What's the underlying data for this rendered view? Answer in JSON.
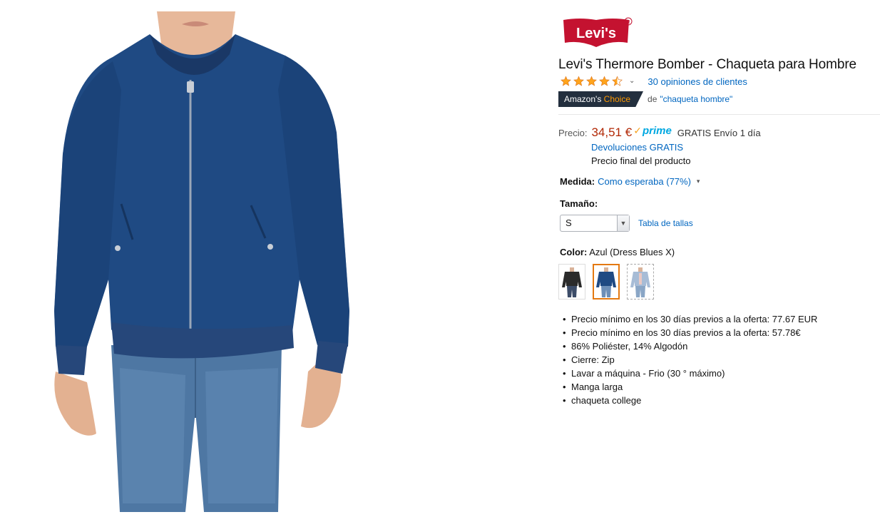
{
  "brand": {
    "logo_text": "Levi's",
    "logo_color": "#c41230"
  },
  "product": {
    "title": "Levi's Thermore Bomber - Chaqueta para Hombre",
    "rating_stars": 4.5,
    "reviews_link": "30 opiniones de clientes",
    "badge_prefix": "Amazon's",
    "badge_highlight": "Choice",
    "badge_for_prefix": "de",
    "badge_keyword": "\"chaqueta hombre\""
  },
  "pricing": {
    "label": "Precio:",
    "value": "34,51 €",
    "prime_check": "✓",
    "prime_word": "prime",
    "shipping": "GRATIS Envío 1 día",
    "returns": "Devoluciones GRATIS",
    "final_note": "Precio final del producto"
  },
  "fit": {
    "label": "Medida:",
    "value": "Como esperaba (77%)"
  },
  "size": {
    "label": "Tamaño:",
    "selected": "S",
    "chart_link": "Tabla de tallas"
  },
  "color": {
    "label": "Color:",
    "selected": "Azul (Dress Blues X)",
    "swatches": [
      "black-jacket",
      "navy-jacket",
      "light-blue-jacket"
    ]
  },
  "colors": {
    "price": "#b12704",
    "link": "#0066c0",
    "prime": "#00a8e1",
    "badge_bg": "#232f3e",
    "badge_accent": "#ff9900",
    "jacket": "#1f4a83"
  },
  "bullets": [
    "Precio mínimo en los 30 días previos a la oferta: 77.67 EUR",
    "Precio mínimo en los 30 días previos a la oferta: 57.78€",
    "86% Poliéster, 14% Algodón",
    "Cierre: Zip",
    "Lavar a máquina - Frio (30 ° máximo)",
    "Manga larga",
    "chaqueta college"
  ]
}
